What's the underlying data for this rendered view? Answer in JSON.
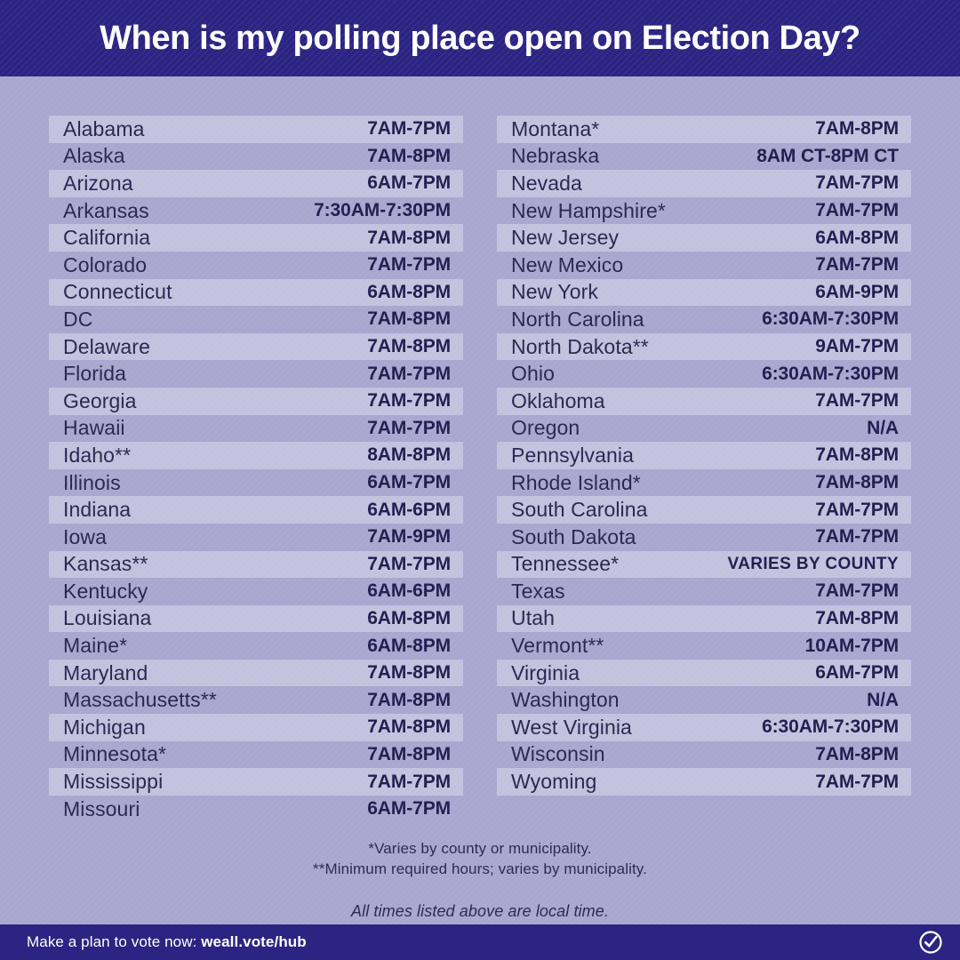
{
  "header": {
    "title": "When is my polling place open on Election Day?"
  },
  "table": {
    "left_column": [
      {
        "state": "Alabama",
        "hours": "7AM-7PM"
      },
      {
        "state": "Alaska",
        "hours": "7AM-8PM"
      },
      {
        "state": "Arizona",
        "hours": "6AM-7PM"
      },
      {
        "state": "Arkansas",
        "hours": "7:30AM-7:30PM"
      },
      {
        "state": "California",
        "hours": "7AM-8PM"
      },
      {
        "state": "Colorado",
        "hours": "7AM-7PM"
      },
      {
        "state": "Connecticut",
        "hours": "6AM-8PM"
      },
      {
        "state": "DC",
        "hours": "7AM-8PM"
      },
      {
        "state": "Delaware",
        "hours": "7AM-8PM"
      },
      {
        "state": "Florida",
        "hours": "7AM-7PM"
      },
      {
        "state": "Georgia",
        "hours": "7AM-7PM"
      },
      {
        "state": "Hawaii",
        "hours": "7AM-7PM"
      },
      {
        "state": "Idaho**",
        "hours": "8AM-8PM"
      },
      {
        "state": "Illinois",
        "hours": "6AM-7PM"
      },
      {
        "state": "Indiana",
        "hours": "6AM-6PM"
      },
      {
        "state": "Iowa",
        "hours": "7AM-9PM"
      },
      {
        "state": "Kansas**",
        "hours": "7AM-7PM"
      },
      {
        "state": "Kentucky",
        "hours": "6AM-6PM"
      },
      {
        "state": "Louisiana",
        "hours": "6AM-8PM"
      },
      {
        "state": "Maine*",
        "hours": "6AM-8PM"
      },
      {
        "state": "Maryland",
        "hours": "7AM-8PM"
      },
      {
        "state": "Massachusetts**",
        "hours": "7AM-8PM"
      },
      {
        "state": "Michigan",
        "hours": "7AM-8PM"
      },
      {
        "state": "Minnesota*",
        "hours": "7AM-8PM"
      },
      {
        "state": "Mississippi",
        "hours": "7AM-7PM"
      },
      {
        "state": "Missouri",
        "hours": "6AM-7PM"
      }
    ],
    "right_column": [
      {
        "state": "Montana*",
        "hours": "7AM-8PM"
      },
      {
        "state": "Nebraska",
        "hours": "8AM CT-8PM CT"
      },
      {
        "state": "Nevada",
        "hours": "7AM-7PM"
      },
      {
        "state": "New Hampshire*",
        "hours": "7AM-7PM"
      },
      {
        "state": "New Jersey",
        "hours": "6AM-8PM"
      },
      {
        "state": "New Mexico",
        "hours": "7AM-7PM"
      },
      {
        "state": "New York",
        "hours": "6AM-9PM"
      },
      {
        "state": "North Carolina",
        "hours": "6:30AM-7:30PM"
      },
      {
        "state": "North Dakota**",
        "hours": "9AM-7PM"
      },
      {
        "state": "Ohio",
        "hours": "6:30AM-7:30PM"
      },
      {
        "state": "Oklahoma",
        "hours": "7AM-7PM"
      },
      {
        "state": "Oregon",
        "hours": "N/A"
      },
      {
        "state": "Pennsylvania",
        "hours": "7AM-8PM"
      },
      {
        "state": "Rhode Island*",
        "hours": "7AM-8PM"
      },
      {
        "state": "South Carolina",
        "hours": "7AM-7PM"
      },
      {
        "state": "South Dakota",
        "hours": "7AM-7PM"
      },
      {
        "state": "Tennessee*",
        "hours": "VARIES BY COUNTY"
      },
      {
        "state": "Texas",
        "hours": "7AM-7PM"
      },
      {
        "state": "Utah",
        "hours": "7AM-8PM"
      },
      {
        "state": "Vermont**",
        "hours": "10AM-7PM"
      },
      {
        "state": "Virginia",
        "hours": "6AM-7PM"
      },
      {
        "state": "Washington",
        "hours": "N/A"
      },
      {
        "state": "West Virginia",
        "hours": "6:30AM-7:30PM"
      },
      {
        "state": "Wisconsin",
        "hours": "7AM-8PM"
      },
      {
        "state": "Wyoming",
        "hours": "7AM-7PM"
      }
    ]
  },
  "footnotes": {
    "single_asterisk": "*Varies by county or municipality.",
    "double_asterisk": "**Minimum required hours; varies by municipality.",
    "local_time_note": "All times listed above are local time."
  },
  "footer": {
    "prefix": "Make a plan to vote now: ",
    "link": "weall.vote/hub",
    "logo_icon": "check-circle-icon"
  },
  "colors": {
    "brand_indigo": "#2b2482",
    "background_lavender": "#a9a6cf",
    "row_stripe": "#c8c5e4",
    "text_dark": "#2a2550",
    "text_white": "#ffffff"
  }
}
